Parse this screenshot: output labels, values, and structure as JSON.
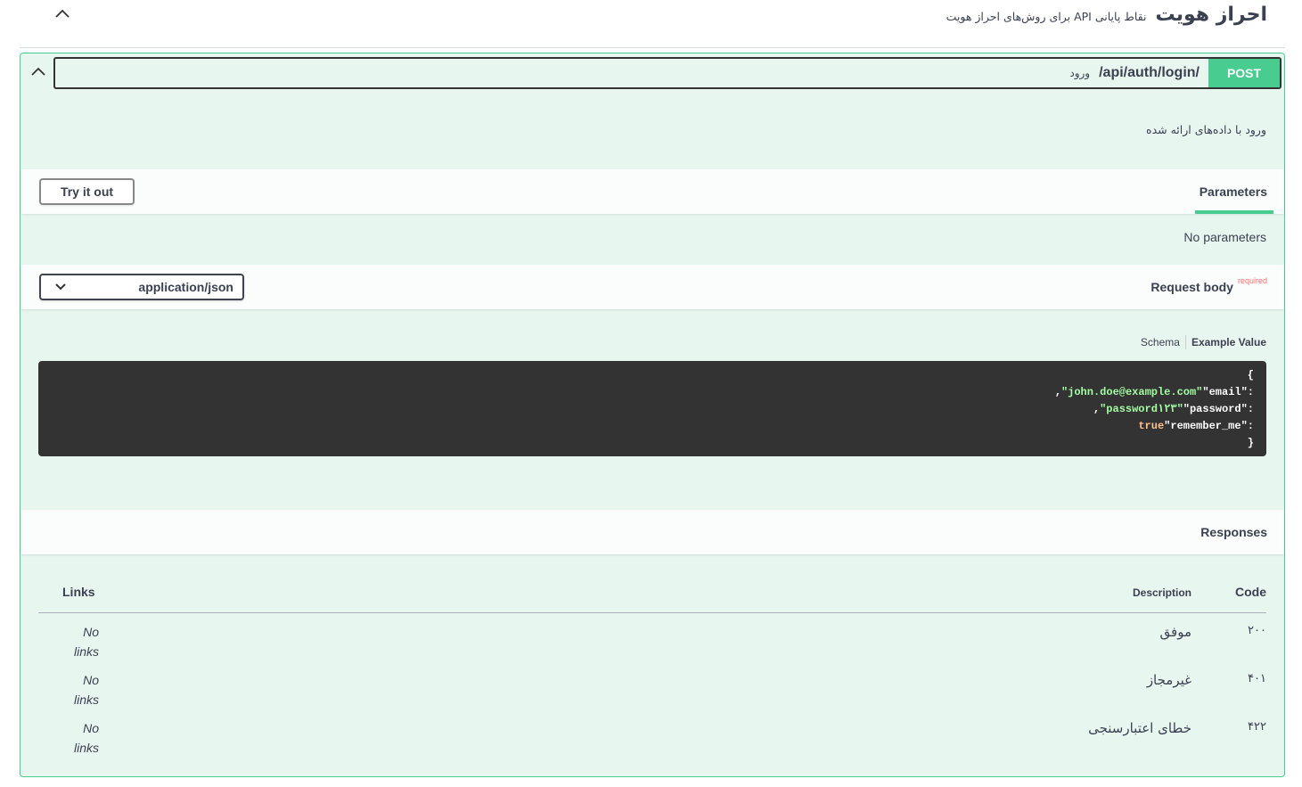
{
  "tag": {
    "name": "احراز هویت",
    "description": "نقاط پایانی API برای روش‌های احراز هویت"
  },
  "operation": {
    "method": "POST",
    "path": "/api/auth/login/",
    "summary": "ورود",
    "description": "ورود با داده‌های ارائه شده"
  },
  "parameters": {
    "tab_label": "Parameters",
    "try_label": "Try it out",
    "empty_text": "No parameters"
  },
  "request_body": {
    "title": "Request body",
    "required_label": "required",
    "content_type": "application/json",
    "tabs": {
      "schema": "Schema",
      "example": "Example Value"
    },
    "example": {
      "open": "{",
      "email_key": "\"email\": ",
      "email_val": "\"john.doe@example.com\"",
      "password_key": "\"password\": ",
      "password_val": "\"password۱۲۳\"",
      "remember_key": "\"remember_me\": ",
      "remember_val": "true",
      "close": "}"
    }
  },
  "responses": {
    "title": "Responses",
    "headers": {
      "code": "Code",
      "description": "Description",
      "links": "Links"
    },
    "rows": [
      {
        "code": "۲۰۰",
        "description": "موفق",
        "links": "No links"
      },
      {
        "code": "۴۰۱",
        "description": "غیرمجاز",
        "links": "No links"
      },
      {
        "code": "۴۲۲",
        "description": "خطای اعتبارسنجی",
        "links": "No links"
      }
    ]
  },
  "colors": {
    "post": "#49cc90",
    "post_bg": "#e8f6f0",
    "code_bg": "#333333",
    "required": "#ff6f6f"
  },
  "icons": {
    "tag_toggle": "chevron-up-icon",
    "op_toggle": "chevron-up-icon",
    "content_type": "chevron-down-icon"
  }
}
